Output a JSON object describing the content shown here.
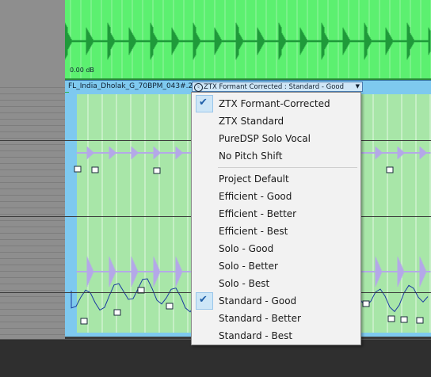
{
  "top_event": {
    "gain_label": "0.00 dB"
  },
  "name_bar": {
    "event_name": "FL_India_Dholak_G_70BPM_043#.2",
    "ztx_icon": "ztx-pitch-icon",
    "ztx_value": "ZTX Formant Corrected : Standard - Good",
    "dropdown_icon": "chevron-down-icon"
  },
  "menu": {
    "modes": [
      {
        "label": "ZTX Formant-Corrected",
        "checked": true
      },
      {
        "label": "ZTX Standard",
        "checked": false
      },
      {
        "label": "PureDSP Solo Vocal",
        "checked": false
      },
      {
        "label": "No Pitch Shift",
        "checked": false
      }
    ],
    "qualities": [
      {
        "label": "Project Default",
        "checked": false
      },
      {
        "label": "Efficient - Good",
        "checked": false
      },
      {
        "label": "Efficient - Better",
        "checked": false
      },
      {
        "label": "Efficient - Best",
        "checked": false
      },
      {
        "label": "Solo - Good",
        "checked": false
      },
      {
        "label": "Solo - Better",
        "checked": false
      },
      {
        "label": "Solo - Best",
        "checked": false
      },
      {
        "label": "Standard - Good",
        "checked": true
      },
      {
        "label": "Standard - Better",
        "checked": false
      },
      {
        "label": "Standard - Best",
        "checked": false
      }
    ],
    "check_glyph": "✔"
  },
  "colors": {
    "top_event_bg": "#5cf070",
    "waveform": "#1f9a3a",
    "name_bar": "#7ec9ef",
    "lower_event_bg": "#a8e6a8",
    "formant_blobs": "#b4a8e8",
    "pitch_line": "#1a3aa0",
    "menu_bg": "#f2f2f2",
    "menu_check_bg": "#cde6f7"
  }
}
